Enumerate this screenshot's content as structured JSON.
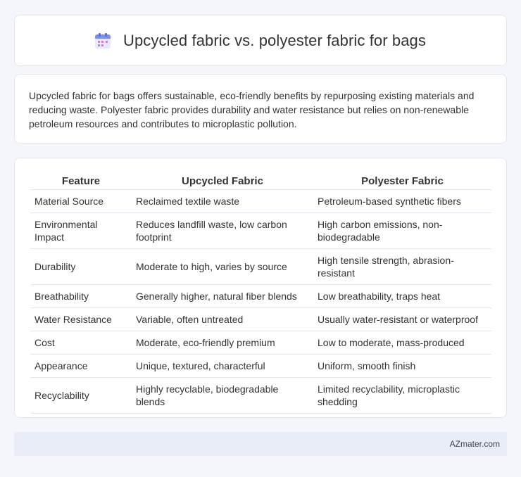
{
  "header": {
    "title": "Upcycled fabric vs. polyester fabric for bags",
    "icon": "calendar-icon"
  },
  "summary": {
    "text": "Upcycled fabric for bags offers sustainable, eco-friendly benefits by repurposing existing materials and reducing waste. Polyester fabric provides durability and water resistance but relies on non-renewable petroleum resources and contributes to microplastic pollution."
  },
  "table": {
    "headers": [
      "Feature",
      "Upcycled Fabric",
      "Polyester Fabric"
    ],
    "rows": [
      [
        "Material Source",
        "Reclaimed textile waste",
        "Petroleum-based synthetic fibers"
      ],
      [
        "Environmental Impact",
        "Reduces landfill waste, low carbon footprint",
        "High carbon emissions, non-biodegradable"
      ],
      [
        "Durability",
        "Moderate to high, varies by source",
        "High tensile strength, abrasion-resistant"
      ],
      [
        "Breathability",
        "Generally higher, natural fiber blends",
        "Low breathability, traps heat"
      ],
      [
        "Water Resistance",
        "Variable, often untreated",
        "Usually water-resistant or waterproof"
      ],
      [
        "Cost",
        "Moderate, eco-friendly premium",
        "Low to moderate, mass-produced"
      ],
      [
        "Appearance",
        "Unique, textured, characterful",
        "Uniform, smooth finish"
      ],
      [
        "Recyclability",
        "Highly recyclable, biodegradable blends",
        "Limited recyclability, microplastic shedding"
      ]
    ]
  },
  "footer": {
    "brand": "AZmater.com"
  },
  "colors": {
    "background": "#f4f6fb",
    "card": "#ffffff",
    "footer_bg": "#e8edf7",
    "icon_accent": "#7b8ff0"
  }
}
